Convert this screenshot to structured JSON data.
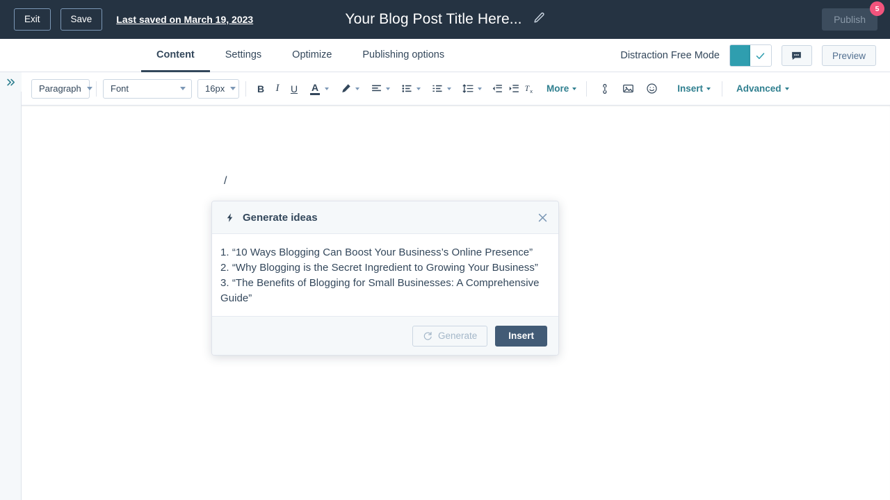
{
  "topbar": {
    "exit_label": "Exit",
    "save_label": "Save",
    "last_saved": "Last saved on March 19, 2023",
    "doc_title": "Your Blog Post Title Here...",
    "edit_icon": "pencil-icon",
    "publish_label": "Publish",
    "publish_badge": "5",
    "badge_color": "#f2547d",
    "background": "#253342"
  },
  "tabbar": {
    "tabs": [
      {
        "label": "Content",
        "active": true
      },
      {
        "label": "Settings",
        "active": false
      },
      {
        "label": "Optimize",
        "active": false
      },
      {
        "label": "Publishing options",
        "active": false
      }
    ],
    "distraction_free_label": "Distraction Free Mode",
    "distraction_free_on": true,
    "toggle_color": "#2f9eaf",
    "comment_icon": "comment-icon",
    "preview_label": "Preview"
  },
  "toolbar": {
    "block_format": "Paragraph",
    "font_family": "Font",
    "font_size": "16px",
    "bold": "B",
    "italic": "I",
    "underline": "U",
    "text_color": "A",
    "more_label": "More",
    "insert_label": "Insert",
    "advanced_label": "Advanced",
    "icons": [
      "bold-icon",
      "italic-icon",
      "underline-icon",
      "text-color-icon",
      "highlight-pen-icon",
      "align-icon",
      "bullet-list-icon",
      "numbered-list-icon",
      "line-height-icon",
      "outdent-icon",
      "indent-icon",
      "clear-formatting-icon",
      "link-icon",
      "image-icon",
      "emoji-icon"
    ],
    "accent_color": "#2f7f8f"
  },
  "sidebar": {
    "expand_icon": "double-chevron-right-icon"
  },
  "editor": {
    "content": "/"
  },
  "modal": {
    "icon": "lightning-bolt-icon",
    "title": "Generate ideas",
    "close_icon": "close-icon",
    "ideas": [
      "1. “10 Ways Blogging Can Boost Your Business’s Online Presence”",
      "2. “Why Blogging is the Secret Ingredient to Growing Your Business”",
      "3. “The Benefits of Blogging for Small Businesses: A Comprehensive Guide”"
    ],
    "generate_label": "Generate",
    "generate_icon": "refresh-icon",
    "insert_label": "Insert",
    "insert_color": "#425b76"
  }
}
